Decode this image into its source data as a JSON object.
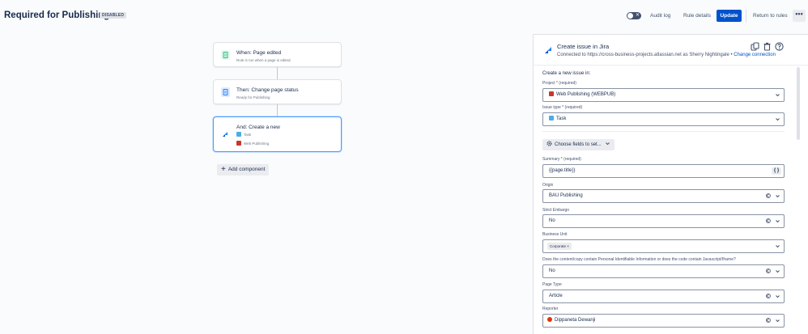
{
  "header": {
    "title": "Required for Publishing",
    "status_badge": "DISABLED",
    "toggle_glyph": "✕",
    "audit_log": "Audit log",
    "rule_details": "Rule details",
    "update": "Update",
    "return_to_rules": "Return to rules",
    "more_glyph": "•••"
  },
  "flow": {
    "trigger": {
      "title": "When: Page edited",
      "subtitle": "Rule is run when a page is edited.",
      "icon": "page-icon",
      "color": "#36b37e"
    },
    "action1": {
      "title": "Then: Change page status",
      "subtitle": "Ready for Publishing",
      "icon": "page-icon",
      "color": "#2684ff"
    },
    "action2": {
      "title": "And: Create a new",
      "line1": "Task",
      "line2": "Web Publishing",
      "icon": "jira-icon",
      "color": "#0052cc"
    },
    "add_component": "Add component",
    "add_glyph": "+"
  },
  "panel": {
    "title": "Create issue in Jira",
    "connected_prefix": "Connected to https://cross-business-projects.atlassian.net as Sherry Nightingale •",
    "change_connection": "Change connection",
    "lead": "Create a new issue in:",
    "choose_fields": "Choose fields to set...",
    "smart_glyph": "{ }",
    "fields": {
      "project": {
        "label": "Project * (required)",
        "value": "Web Publishing (WEBPUB)"
      },
      "issue_type": {
        "label": "Issue type * (required)",
        "value": "Task"
      },
      "summary": {
        "label": "Summary * (required)",
        "value": "{{page.title}}"
      },
      "origin": {
        "label": "Origin",
        "value": "BAU Publishing"
      },
      "strict_embargo": {
        "label": "Strict Embargo",
        "value": "No"
      },
      "business_unit": {
        "label": "Business Unit",
        "value": "Corporate",
        "chip_x": "×"
      },
      "pii": {
        "label": "Does the content/copy contain Personal Identifiable Information or does the code contain Javascript/Iframe?",
        "value": "No"
      },
      "page_type": {
        "label": "Page Type",
        "value": "Article"
      },
      "reporter": {
        "label": "Reporter",
        "value": "Dippaneta Dewanji"
      }
    }
  },
  "colors": {
    "accent": "#0052cc",
    "project_icon": "#c9372c",
    "task_icon": "#4bade8",
    "reporter_avatar": "#de350b"
  }
}
